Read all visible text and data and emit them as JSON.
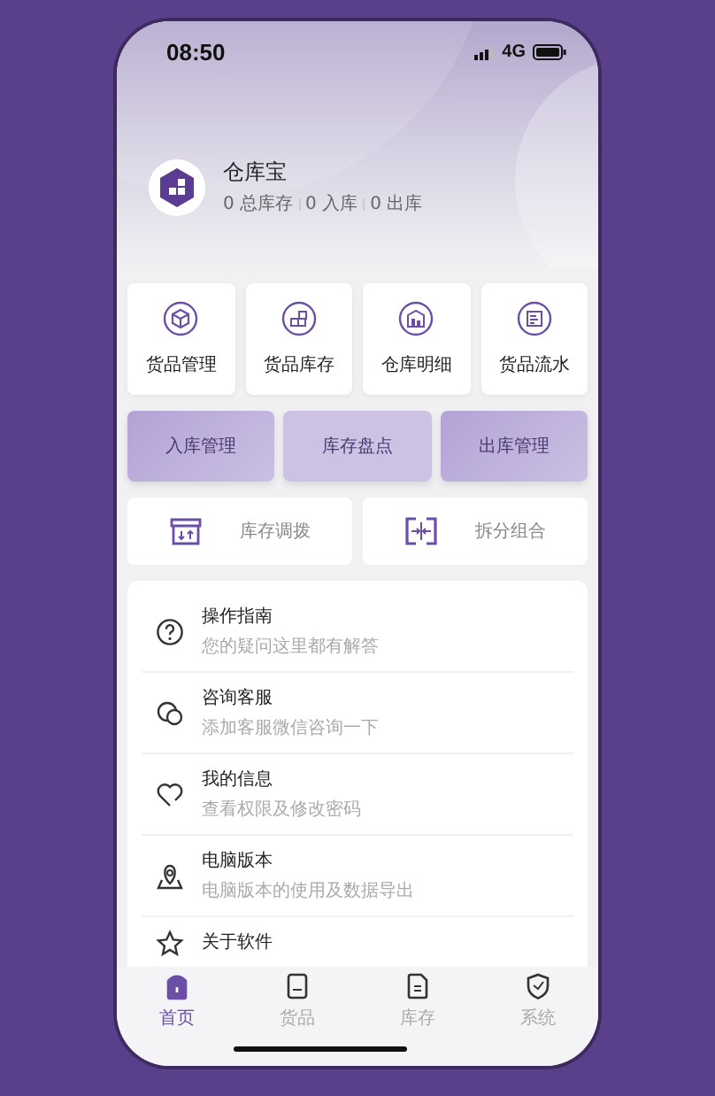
{
  "status_bar": {
    "time": "08:50",
    "network": "4G"
  },
  "header": {
    "app_name": "仓库宝",
    "stats": [
      "0 总库存",
      "0 入库",
      "0 出库"
    ]
  },
  "shortcuts": [
    {
      "label": "货品管理"
    },
    {
      "label": "货品库存"
    },
    {
      "label": "仓库明细"
    },
    {
      "label": "货品流水"
    }
  ],
  "actions": [
    "入库管理",
    "库存盘点",
    "出库管理"
  ],
  "tools": [
    "库存调拨",
    "拆分组合"
  ],
  "menu": [
    {
      "title": "操作指南",
      "subtitle": "您的疑问这里都有解答"
    },
    {
      "title": "咨询客服",
      "subtitle": "添加客服微信咨询一下"
    },
    {
      "title": "我的信息",
      "subtitle": "查看权限及修改密码"
    },
    {
      "title": "电脑版本",
      "subtitle": "电脑版本的使用及数据导出"
    },
    {
      "title": "关于软件"
    }
  ],
  "tab_bar": [
    {
      "label": "首页",
      "selected": true
    },
    {
      "label": "货品",
      "selected": false
    },
    {
      "label": "库存",
      "selected": false
    },
    {
      "label": "系统",
      "selected": false
    }
  ]
}
